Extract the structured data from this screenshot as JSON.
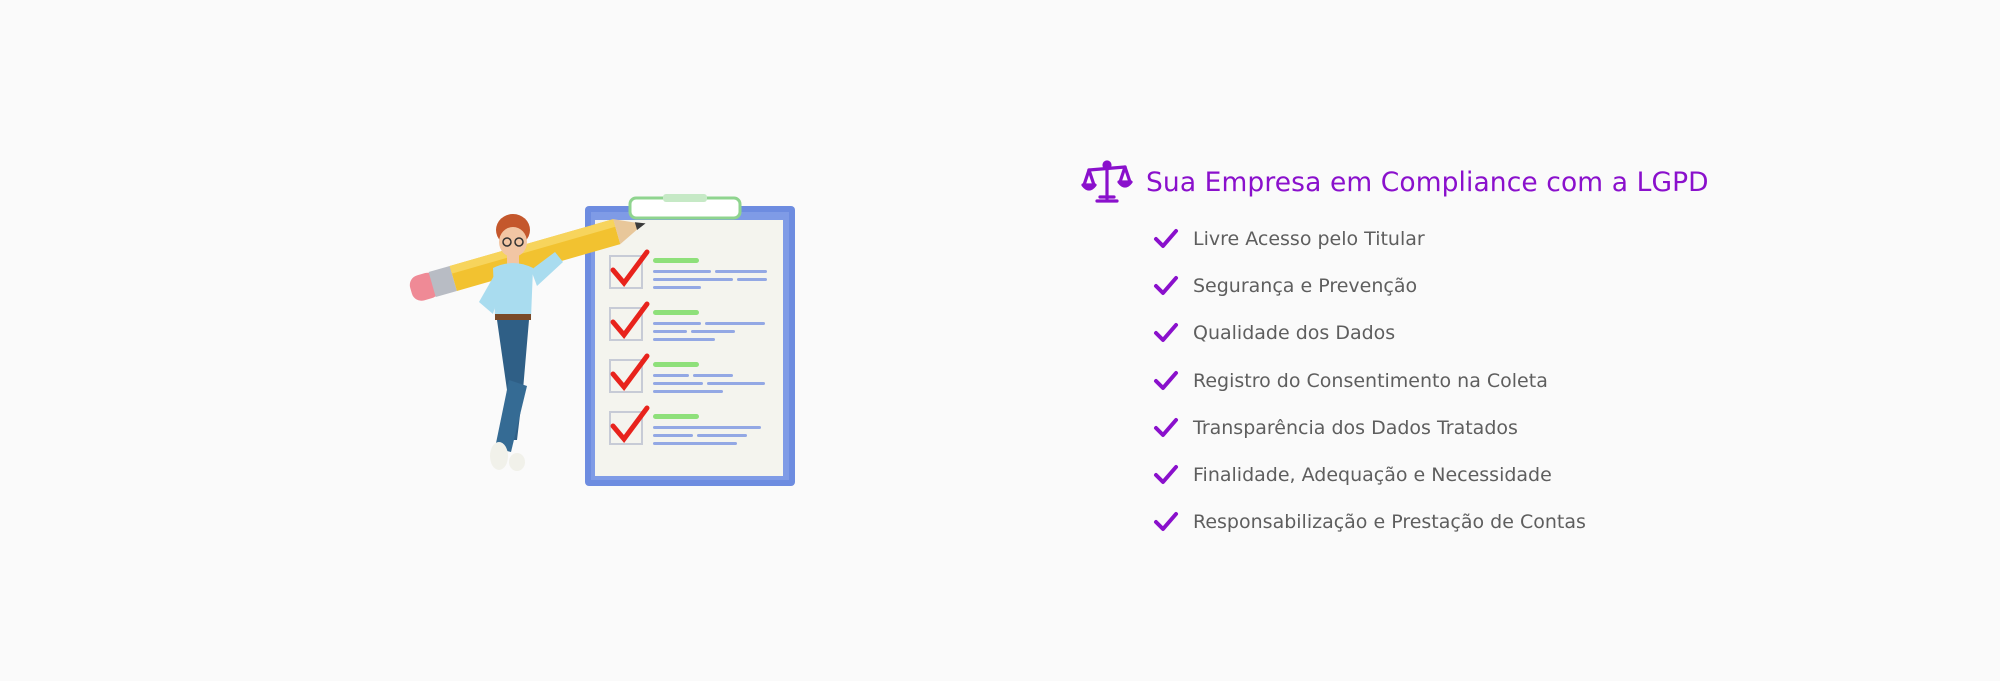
{
  "colors": {
    "background": "#fafafa",
    "accent": "#8a10cc",
    "text": "#5e5e5e"
  },
  "illustration": {
    "icon": "person-with-pencil-and-checklist-clipboard"
  },
  "compliance": {
    "icon": "scale-of-justice-icon",
    "title": "Sua Empresa em Compliance com a LGPD",
    "check_icon": "checkmark-icon",
    "items": [
      "Livre Acesso pelo Titular",
      "Segurança e Prevenção",
      "Qualidade dos Dados",
      "Registro do Consentimento na Coleta",
      "Transparência dos Dados Tratados",
      "Finalidade, Adequação e Necessidade",
      "Responsabilização e Prestação de Contas"
    ]
  }
}
